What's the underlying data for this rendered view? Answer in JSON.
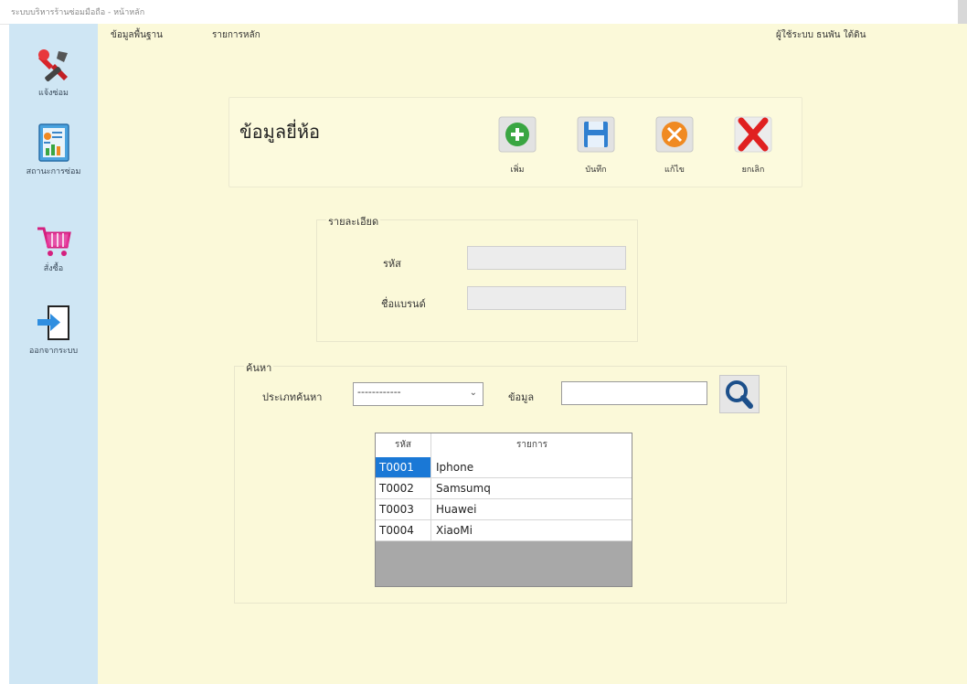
{
  "window": {
    "title": "ระบบบริหารร้านซ่อมมือถือ - หน้าหลัก"
  },
  "sidebar": {
    "items": [
      {
        "label": "แจ้งซ่อม",
        "icon": "repair-tools-icon"
      },
      {
        "label": "สถานะการซ่อม",
        "icon": "report-chart-icon"
      },
      {
        "label": "สั่งซื้อ",
        "icon": "shopping-cart-icon"
      },
      {
        "label": "ออกจากระบบ",
        "icon": "logout-icon"
      }
    ]
  },
  "menubar": {
    "items": [
      "ข้อมูลพื้นฐาน",
      "รายการหลัก"
    ],
    "user": "ผู้ใช้ระบบ  ธนพัน ใต้ดิน"
  },
  "header": {
    "title": "ข้อมูลยี่ห้อ",
    "buttons": [
      {
        "label": "เพิ่ม",
        "icon": "add-icon",
        "color": "#3aa642"
      },
      {
        "label": "บันทึก",
        "icon": "save-icon",
        "color": "#2f7fd0"
      },
      {
        "label": "แก้ไข",
        "icon": "edit-tools-icon",
        "color": "#f08a22"
      },
      {
        "label": "ยกเลิก",
        "icon": "cancel-icon",
        "color": "#e02020"
      }
    ]
  },
  "details": {
    "group_title": "รายละเอียด",
    "code_label": "รหัส",
    "code_value": "",
    "brand_label": "ชื่อแบรนด์",
    "brand_value": ""
  },
  "search": {
    "group_title": "ค้นหา",
    "type_label": "ประเภทค้นหา",
    "type_value": "------------",
    "data_label": "ข้อมูล",
    "data_value": ""
  },
  "grid": {
    "columns": [
      "รหัส",
      "รายการ"
    ],
    "rows": [
      {
        "code": "T0001",
        "name": "Iphone"
      },
      {
        "code": "T0002",
        "name": "Samsumq"
      },
      {
        "code": "T0003",
        "name": "Huawei"
      },
      {
        "code": "T0004",
        "name": "XiaoMi"
      }
    ]
  },
  "colors": {
    "sidebar_bg": "#cfe6f4",
    "main_bg": "#fbf9d9",
    "selection": "#1a78d6"
  }
}
